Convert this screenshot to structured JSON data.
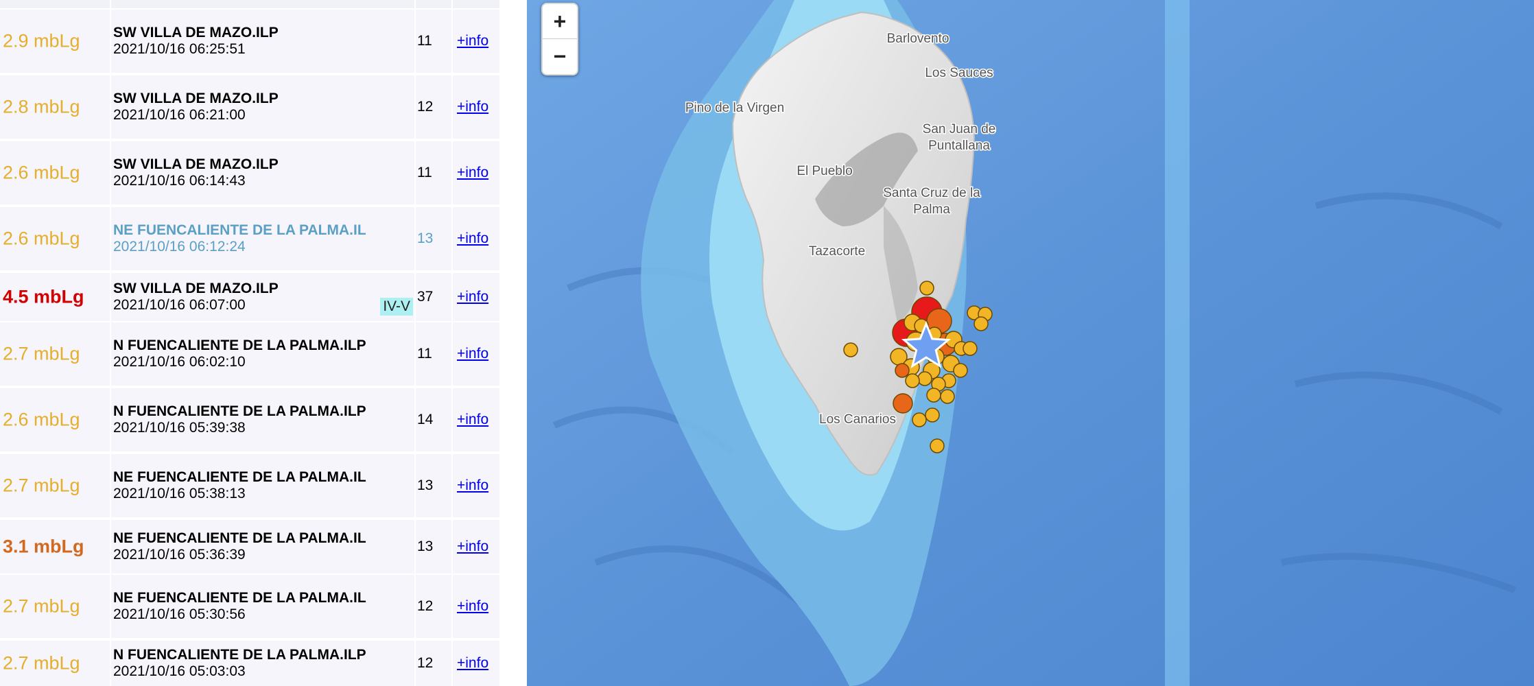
{
  "quakes": [
    {
      "mag": "2.9 mbLg",
      "mag_color": "#e5ae2b",
      "location": "SW VILLA DE MAZO.ILP",
      "datetime": "2021/10/16 06:25:51",
      "count": "11",
      "info": "+info"
    },
    {
      "mag": "2.8 mbLg",
      "mag_color": "#e5ae2b",
      "location": "SW VILLA DE MAZO.ILP",
      "datetime": "2021/10/16 06:21:00",
      "count": "12",
      "info": "+info"
    },
    {
      "mag": "2.6 mbLg",
      "mag_color": "#e5ae2b",
      "location": "SW VILLA DE MAZO.ILP",
      "datetime": "2021/10/16 06:14:43",
      "count": "11",
      "info": "+info"
    },
    {
      "mag": "2.6 mbLg",
      "mag_color": "#e5ae2b",
      "location": "NE FUENCALIENTE DE LA PALMA.IL",
      "datetime": "2021/10/16 06:12:24",
      "count": "13",
      "info": "+info",
      "text_color": "#5b9fc6"
    },
    {
      "mag": "4.5 mbLg",
      "mag_color": "#d40000",
      "location": "SW VILLA DE MAZO.ILP",
      "datetime": "2021/10/16 06:07:00",
      "count": "37",
      "info": "+info",
      "intensity": "IV-V",
      "bold": true
    },
    {
      "mag": "2.7 mbLg",
      "mag_color": "#e5ae2b",
      "location": "N FUENCALIENTE DE LA PALMA.ILP",
      "datetime": "2021/10/16 06:02:10",
      "count": "11",
      "info": "+info"
    },
    {
      "mag": "2.6 mbLg",
      "mag_color": "#e5ae2b",
      "location": "N FUENCALIENTE DE LA PALMA.ILP",
      "datetime": "2021/10/16 05:39:38",
      "count": "14",
      "info": "+info"
    },
    {
      "mag": "2.7 mbLg",
      "mag_color": "#e5ae2b",
      "location": "NE FUENCALIENTE DE LA PALMA.IL",
      "datetime": "2021/10/16 05:38:13",
      "count": "13",
      "info": "+info"
    },
    {
      "mag": "3.1 mbLg",
      "mag_color": "#d2691e",
      "location": "NE FUENCALIENTE DE LA PALMA.IL",
      "datetime": "2021/10/16 05:36:39",
      "count": "13",
      "info": "+info",
      "bold": true
    },
    {
      "mag": "2.7 mbLg",
      "mag_color": "#e5ae2b",
      "location": "NE FUENCALIENTE DE LA PALMA.IL",
      "datetime": "2021/10/16 05:30:56",
      "count": "12",
      "info": "+info"
    },
    {
      "mag": "2.7 mbLg",
      "mag_color": "#e5ae2b",
      "location": "N FUENCALIENTE DE LA PALMA.ILP",
      "datetime": "2021/10/16 05:03:03",
      "count": "12",
      "info": "+info"
    }
  ],
  "map": {
    "zoom_in": "+",
    "zoom_out": "−",
    "places": {
      "barlovento": "Barlovento",
      "los_sauces": "Los Sauces",
      "pino": "Pino de la Virgen",
      "san_juan_1": "San Juan de",
      "san_juan_2": "Puntallana",
      "el_pueblo": "El Pueblo",
      "santa_cruz_1": "Santa Cruz de la",
      "santa_cruz_2": "Palma",
      "tazacorte": "Tazacorte",
      "los_canarios": "Los Canarios"
    },
    "colors": {
      "ocean": "#5b93d8",
      "shelf": "#8ed6f2",
      "land": "#e9e9e9",
      "minor": "#f2b526",
      "medium": "#e8661a",
      "major": "#e61a1a",
      "epicenter": "#6e9ff0"
    }
  }
}
